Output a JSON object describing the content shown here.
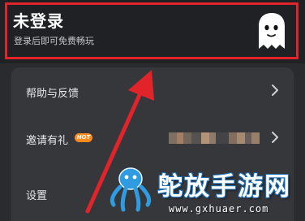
{
  "header": {
    "title": "未登录",
    "subtitle": "登录后即可免费畅玩",
    "avatar_icon": "ghost-icon"
  },
  "menu": {
    "items": [
      {
        "label": "帮助与反馈",
        "icon": "chevron-right-icon"
      },
      {
        "label": "邀请有礼",
        "badge": "HOT",
        "icon": "chevron-right-icon"
      },
      {
        "label": "设置"
      }
    ]
  },
  "watermark": {
    "name": "鸵放手游网",
    "url": "www.gxhuaer.com"
  },
  "colors": {
    "highlight": "#e0242a",
    "arrow": "#e0242a",
    "badge": "#ff8a1f",
    "card": "#36373b",
    "background": "#2a2b2e"
  }
}
